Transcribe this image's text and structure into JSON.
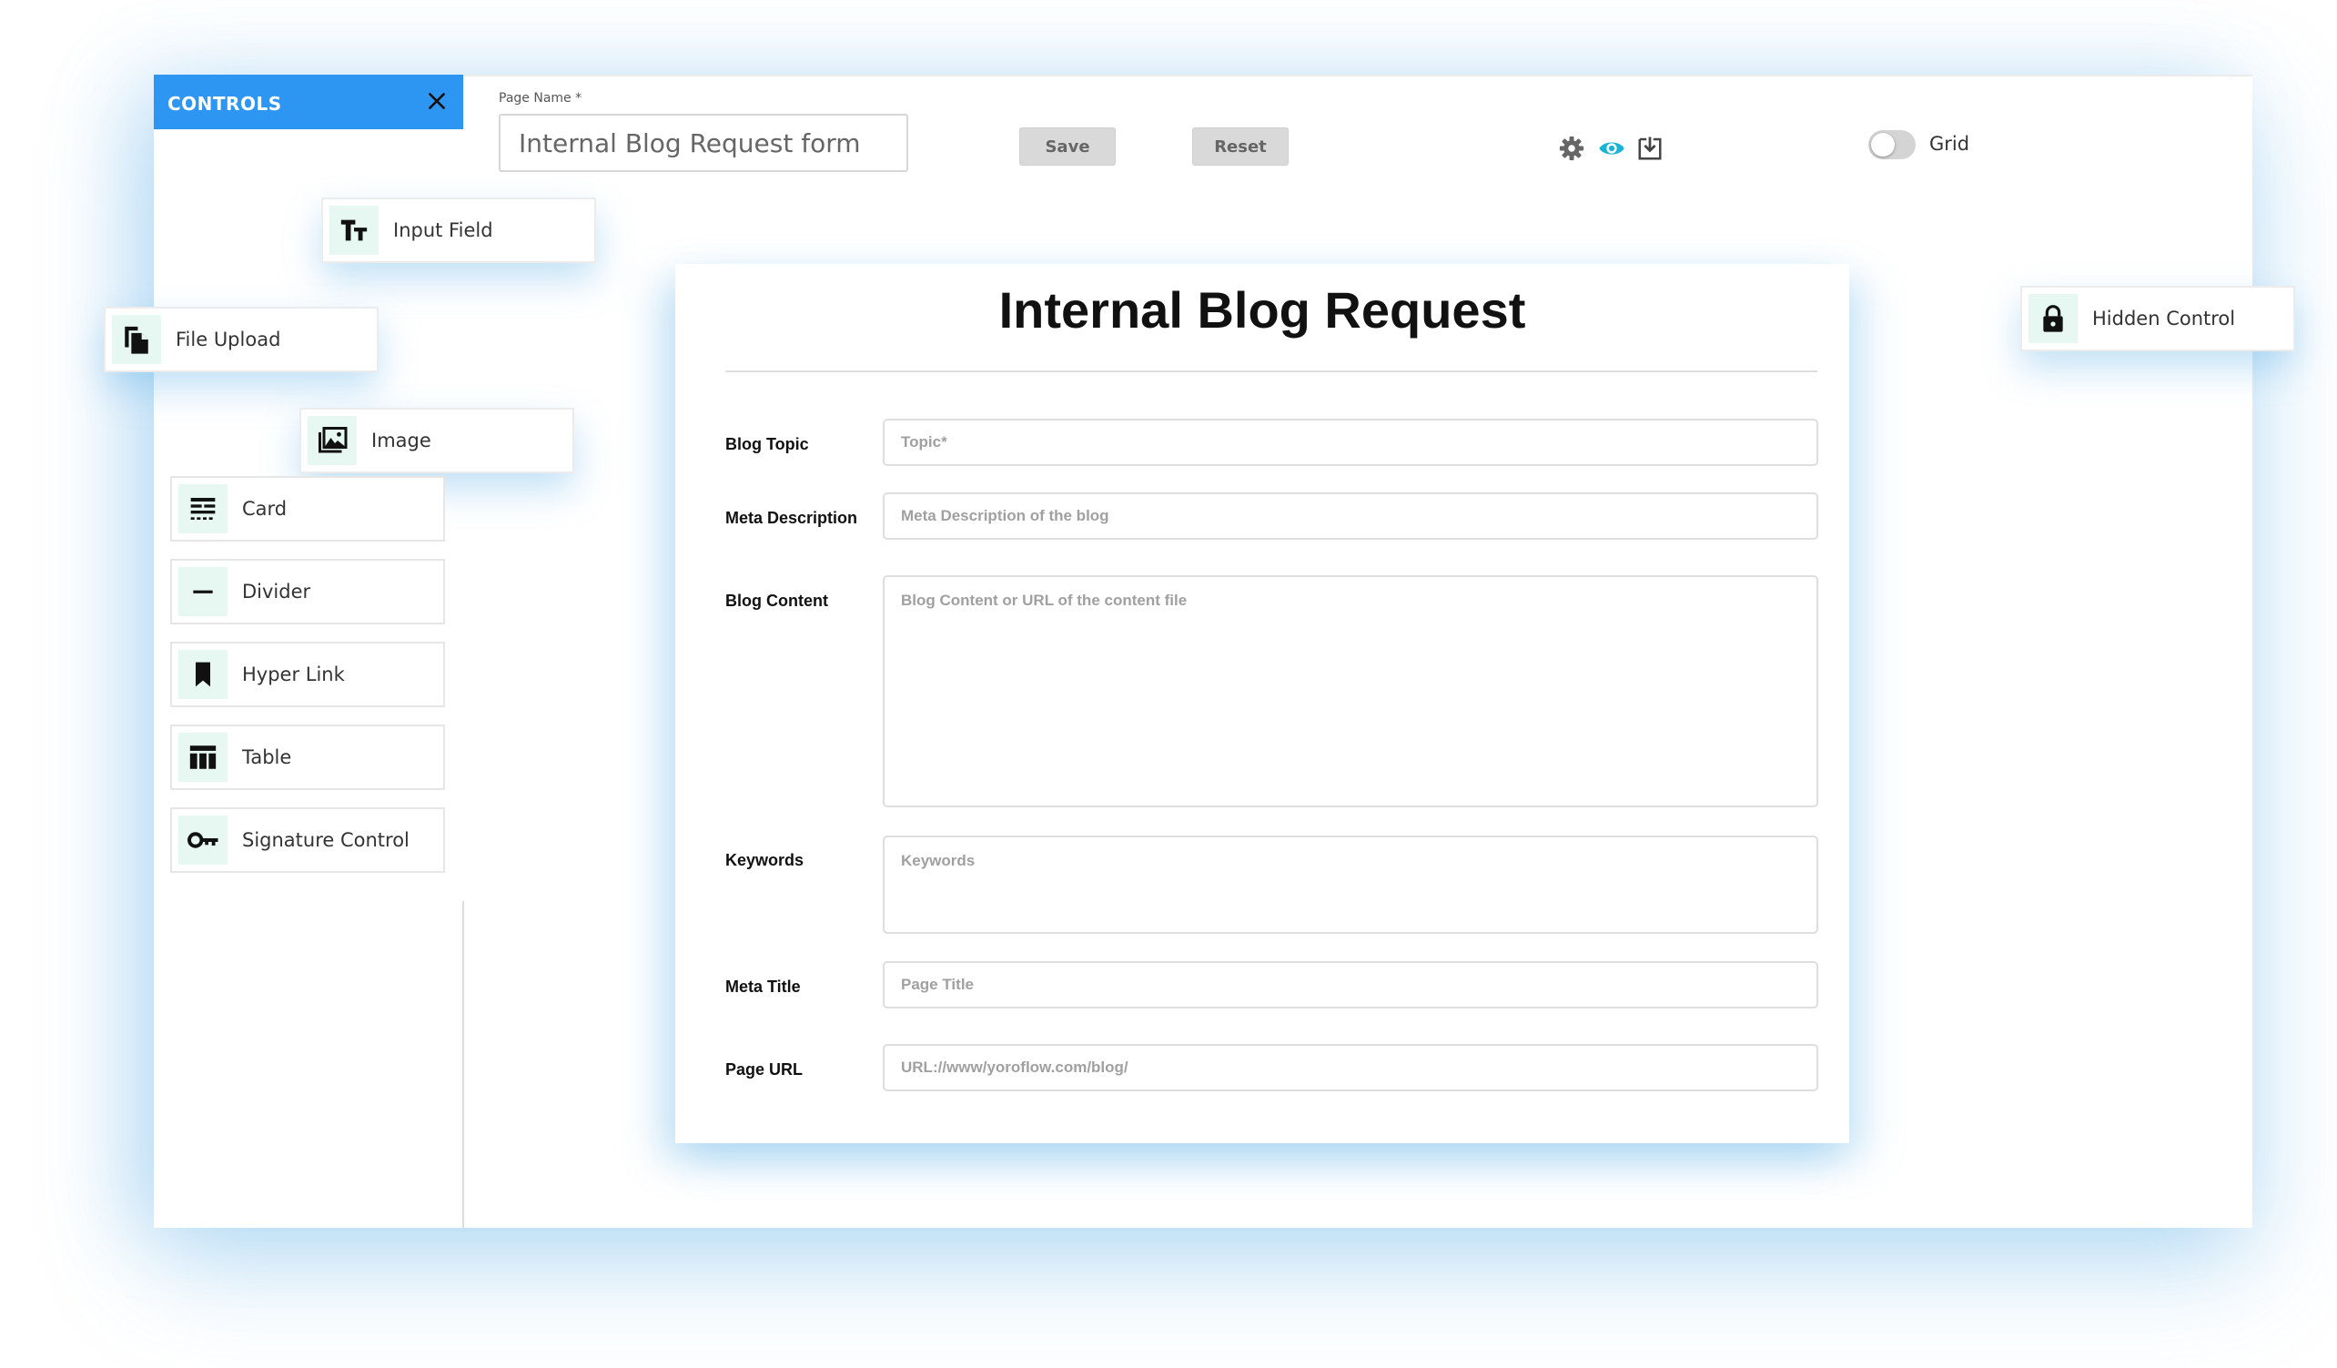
{
  "controls_panel": {
    "title": "CONTROLS",
    "items": [
      {
        "label": "Input Field",
        "icon": "text-type-icon"
      },
      {
        "label": "File Upload",
        "icon": "file-copy-icon"
      },
      {
        "label": "Image",
        "icon": "image-gallery-icon"
      },
      {
        "label": "Card",
        "icon": "card-layout-icon"
      },
      {
        "label": "Divider",
        "icon": "minus-icon"
      },
      {
        "label": "Hyper Link",
        "icon": "bookmark-icon"
      },
      {
        "label": "Table",
        "icon": "table-icon"
      },
      {
        "label": "Signature Control",
        "icon": "key-icon"
      },
      {
        "label": "Hidden Control",
        "icon": "lock-icon"
      }
    ]
  },
  "toolbar": {
    "page_name_label": "Page Name *",
    "page_name_value": "Internal Blog Request form",
    "save_label": "Save",
    "reset_label": "Reset",
    "icons": [
      "gear-icon",
      "eye-icon",
      "download-icon"
    ],
    "grid_label": "Grid",
    "grid_enabled": false,
    "accent_color": "#2d96f2",
    "eye_color": "#1ab4d4"
  },
  "form": {
    "title": "Internal Blog Request",
    "fields": [
      {
        "label": "Blog Topic",
        "placeholder": "Topic*"
      },
      {
        "label": "Meta Description",
        "placeholder": "Meta Description of the blog"
      },
      {
        "label": "Blog Content",
        "placeholder": "Blog Content or URL of the content file"
      },
      {
        "label": "Keywords",
        "placeholder": "Keywords"
      },
      {
        "label": "Meta Title",
        "placeholder": "Page Title"
      },
      {
        "label": "Page URL",
        "placeholder": "URL://www/yoroflow.com/blog/"
      }
    ]
  }
}
